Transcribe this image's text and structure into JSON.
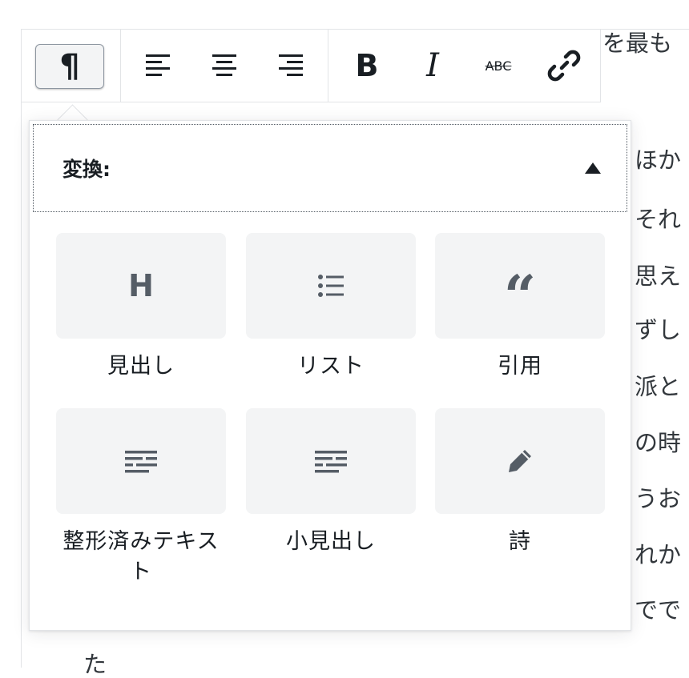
{
  "toolbar": {
    "paragraph_symbol": "¶",
    "bold_label": "B",
    "italic_label": "I",
    "strikethrough_label": "ABC",
    "icons": [
      "pilcrow-icon",
      "align-left-icon",
      "align-center-icon",
      "align-right-icon",
      "bold-icon",
      "italic-icon",
      "strikethrough-icon",
      "link-icon"
    ]
  },
  "panel": {
    "title": "変換:",
    "tiles": [
      {
        "label": "見出し",
        "icon": "heading-icon",
        "glyph": "H"
      },
      {
        "label": "リスト",
        "icon": "list-icon"
      },
      {
        "label": "引用",
        "icon": "quote-icon",
        "glyph": "“"
      },
      {
        "label": "整形済みテキスト",
        "icon": "preformatted-icon"
      },
      {
        "label": "小見出し",
        "icon": "subheading-icon"
      },
      {
        "label": "詩",
        "icon": "pencil-icon"
      }
    ]
  },
  "background_text": {
    "top_line": "を最も",
    "lines": [
      "ほか",
      "それ",
      "思え",
      "ずし",
      "派と",
      "の時",
      "うお",
      "れか",
      "でで"
    ],
    "bottom": "た"
  },
  "colors": {
    "border": "#e2e4e7",
    "tile_bg": "#f3f4f5",
    "icon": "#555d66",
    "text": "#191e23"
  }
}
